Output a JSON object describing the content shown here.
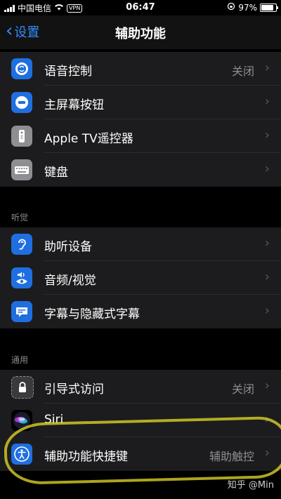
{
  "status_bar": {
    "carrier": "中国电信",
    "vpn": "VPN",
    "time": "06:47",
    "battery": "97%",
    "battery_fraction": 0.97
  },
  "nav": {
    "back_label": "设置",
    "title": "辅助功能"
  },
  "sections": [
    {
      "header": "",
      "items": [
        {
          "label": "语音控制",
          "value": "关闭",
          "icon": "voice-control-icon"
        },
        {
          "label": "主屏幕按钮",
          "value": "",
          "icon": "home-button-icon"
        },
        {
          "label": "Apple TV遥控器",
          "value": "",
          "icon": "apple-tv-remote-icon"
        },
        {
          "label": "键盘",
          "value": "",
          "icon": "keyboard-icon"
        }
      ]
    },
    {
      "header": "听觉",
      "items": [
        {
          "label": "助听设备",
          "value": "",
          "icon": "ear-icon"
        },
        {
          "label": "音频/视觉",
          "value": "",
          "icon": "audio-visual-icon"
        },
        {
          "label": "字幕与隐藏式字幕",
          "value": "",
          "icon": "subtitles-icon"
        }
      ]
    },
    {
      "header": "通用",
      "items": [
        {
          "label": "引导式访问",
          "value": "关闭",
          "icon": "lock-icon"
        },
        {
          "label": "Siri",
          "value": "",
          "icon": "siri-icon"
        },
        {
          "label": "辅助功能快捷键",
          "value": "辅助触控",
          "icon": "accessibility-icon"
        }
      ]
    }
  ],
  "watermark": "知乎 @Min"
}
